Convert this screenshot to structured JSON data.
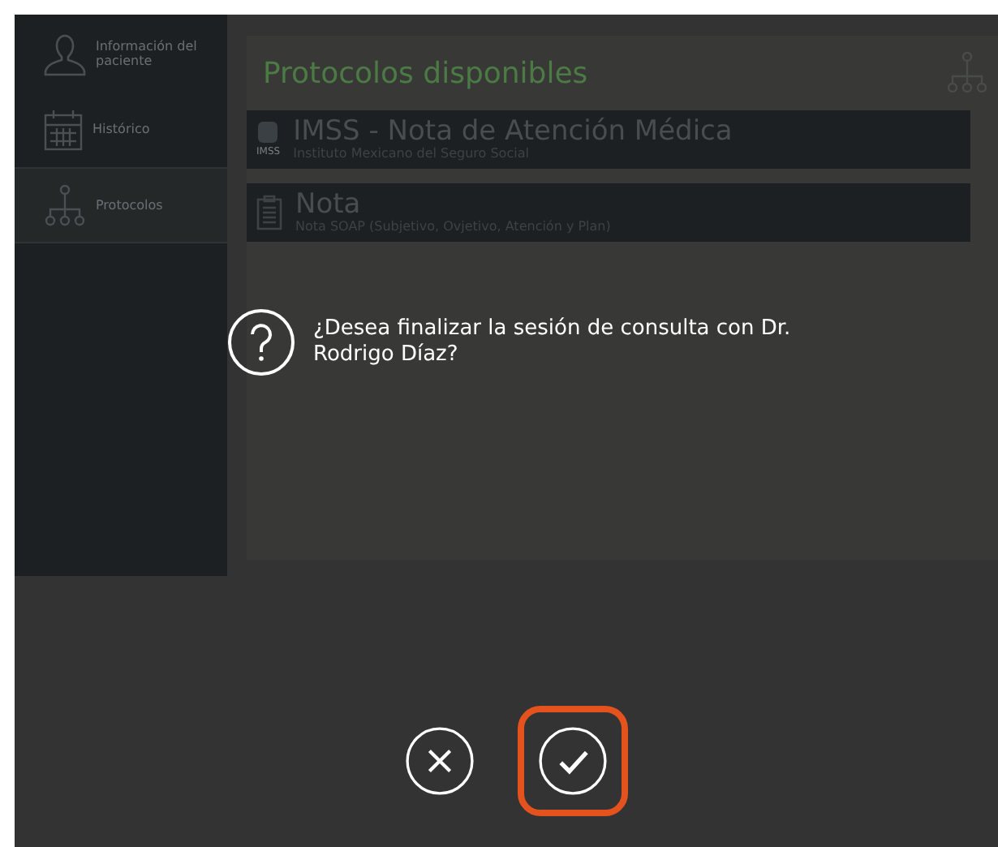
{
  "sidebar": {
    "items": [
      {
        "label": "Información del paciente",
        "selected": false
      },
      {
        "label": "Histórico",
        "selected": false
      },
      {
        "label": "Protocolos",
        "selected": true
      }
    ]
  },
  "main": {
    "title": "Protocolos disponibles",
    "protocols": [
      {
        "title": "IMSS - Nota de Atención Médica",
        "subtitle": "Instituto Mexicano del Seguro Social",
        "logo_text": "IMSS"
      },
      {
        "title": "Nota",
        "subtitle": "Nota SOAP (Subjetivo, Ovjetivo, Atención y Plan)"
      }
    ]
  },
  "dialog": {
    "message": "¿Desea finalizar la sesión de consulta con Dr. Rodrigo Díaz?",
    "buttons": [
      {
        "kind": "cancel",
        "selected": false
      },
      {
        "kind": "confirm",
        "selected": true
      }
    ]
  }
}
